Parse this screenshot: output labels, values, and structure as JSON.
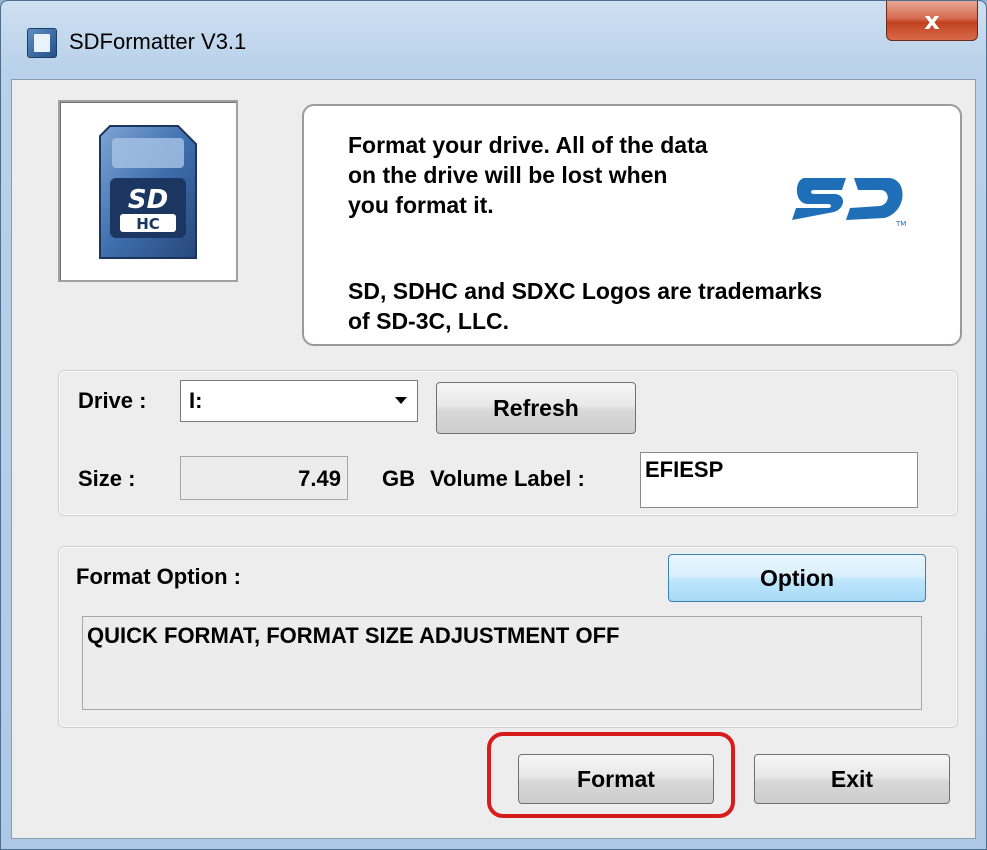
{
  "window": {
    "title": "SDFormatter V3.1",
    "close_symbol": "x"
  },
  "info": {
    "line1": "Format your drive. All of the data",
    "line2": "on the drive will be lost when",
    "line3": "you format it.",
    "line4": "SD, SDHC and SDXC Logos are trademarks",
    "line5": "of SD-3C, LLC."
  },
  "drive": {
    "label": "Drive :",
    "selected": "I:",
    "refresh_label": "Refresh",
    "size_label": "Size  :",
    "size_value": "7.49",
    "size_unit": "GB",
    "volume_label_label": "Volume Label  :",
    "volume_label_value": "EFIESP"
  },
  "format_option": {
    "label": "Format Option :",
    "option_button": "Option",
    "summary": "QUICK FORMAT, FORMAT SIZE ADJUSTMENT OFF"
  },
  "actions": {
    "format_label": "Format",
    "exit_label": "Exit"
  },
  "icons": {
    "app": "sd-card-app-icon",
    "card": "sdhc-card-icon",
    "logo": "sd-logo"
  },
  "colors": {
    "highlight": "#d81c1c",
    "sd_blue": "#1e6fb8"
  }
}
